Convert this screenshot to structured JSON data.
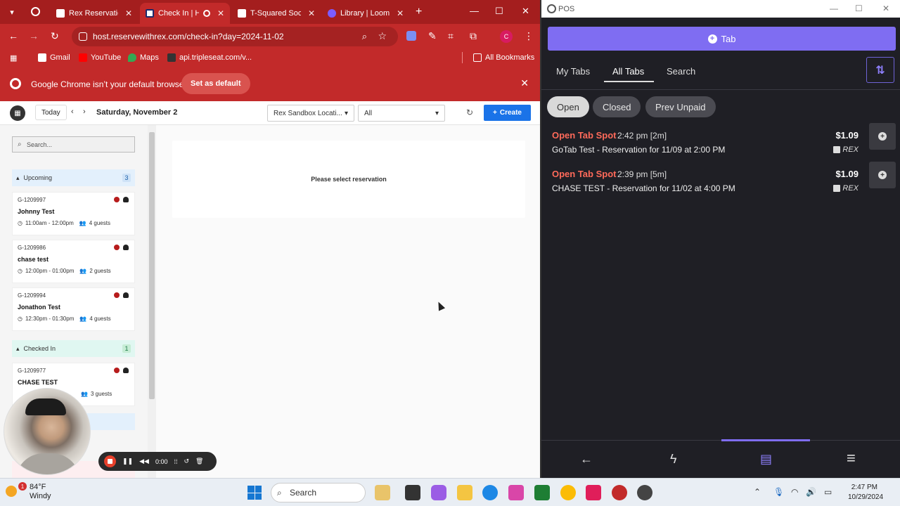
{
  "browser": {
    "tabs": [
      {
        "title": "Rex Reservation"
      },
      {
        "title": "Check In | H"
      },
      {
        "title": "T-Squared Soci"
      },
      {
        "title": "Library | Loom"
      }
    ],
    "url": "host.reservewithrex.com/check-in?day=2024-11-02",
    "profile_initial": "C",
    "bookmarks": [
      "Gmail",
      "YouTube",
      "Maps",
      "api.tripleseat.com/v..."
    ],
    "all_bookmarks": "All Bookmarks",
    "infobar": {
      "message": "Google Chrome isn’t your default browser",
      "action": "Set as default"
    }
  },
  "app": {
    "today_label": "Today",
    "date_label": "Saturday, November 2",
    "location_select": "Rex Sandbox Locati...",
    "filter_select": "All",
    "create_label": "Create",
    "search_placeholder": "Search...",
    "sections": {
      "upcoming": {
        "label": "Upcoming",
        "count": "3"
      },
      "checked_in": {
        "label": "Checked In",
        "count": "1"
      }
    },
    "reservations": [
      {
        "id": "G-1209997",
        "name": "Johnny Test",
        "time": "11:00am - 12:00pm",
        "guests": "4 guests"
      },
      {
        "id": "G-1209986",
        "name": "chase test",
        "time": "12:00pm - 01:00pm",
        "guests": "2 guests"
      },
      {
        "id": "G-1209994",
        "name": "Jonathon Test",
        "time": "12:30pm - 01:30pm",
        "guests": "4 guests"
      },
      {
        "id": "G-1209977",
        "name": "CHASE TEST",
        "time": "",
        "guests": "3 guests"
      }
    ],
    "empty_message": "Please select reservation"
  },
  "recorder": {
    "timer": "0:00"
  },
  "pos": {
    "window_title": "POS",
    "tab_button": "Tab",
    "tabs": [
      "My Tabs",
      "All Tabs",
      "Search"
    ],
    "filters": [
      "Open",
      "Closed",
      "Prev Unpaid"
    ],
    "rows": [
      {
        "spot": "Open Tab Spot",
        "time": "2:42 pm [2m]",
        "desc": "GoTab Test - Reservation for 11/09 at 2:00 PM",
        "amount": "$1.09",
        "source": "REX"
      },
      {
        "spot": "Open Tab Spot",
        "time": "2:39 pm [5m]",
        "desc": "CHASE TEST - Reservation for 11/02 at 4:00 PM",
        "amount": "$1.09",
        "source": "REX"
      }
    ]
  },
  "taskbar": {
    "weather_temp": "84°F",
    "weather_cond": "Windy",
    "weather_badge": "1",
    "search": "Search",
    "time": "2:47 PM",
    "date": "10/29/2024"
  },
  "colors": {
    "chrome_theme": "#c22a2a",
    "pos_accent": "#7f6df2",
    "pos_bg": "#1f1f25",
    "open_tab": "#ff6a5a",
    "create_btn": "#1a73e8"
  }
}
